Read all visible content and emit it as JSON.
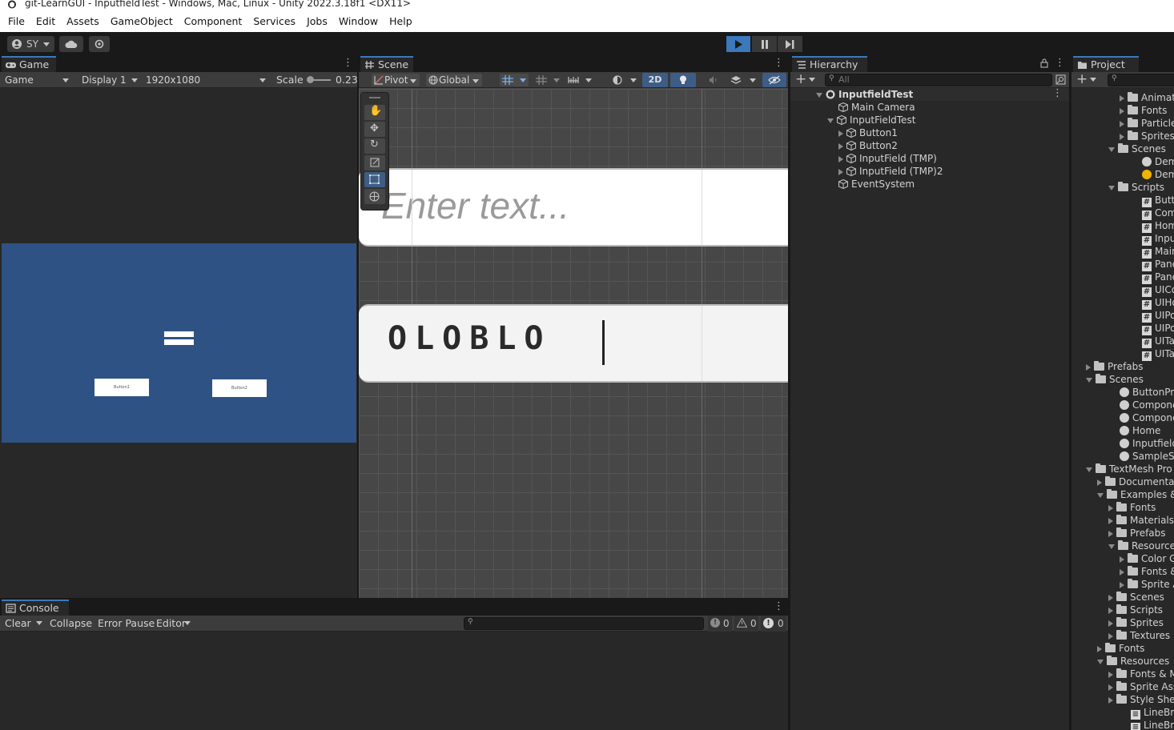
{
  "window_title": "git-LearnGUI - InputfieldTest - Windows, Mac, Linux - Unity 2022.3.18f1 <DX11>",
  "menu": [
    "File",
    "Edit",
    "Assets",
    "GameObject",
    "Component",
    "Services",
    "Jobs",
    "Window",
    "Help"
  ],
  "toolbar": {
    "account_label": "SY"
  },
  "game": {
    "tab": "Game",
    "mode": "Game",
    "display": "Display 1",
    "resolution": "1920x1080",
    "scale_label": "Scale",
    "scale_value": "0.23",
    "button1_label": "Button1",
    "button2_label": "Button2",
    "bg_color": "#2e5283"
  },
  "scene": {
    "tab": "Scene",
    "pivot": "Pivot",
    "global": "Global",
    "mode_2d": "2D",
    "input_placeholder": "Enter text...",
    "input_value": "OLOBLO"
  },
  "hierarchy": {
    "tab": "Hierarchy",
    "search_placeholder": "All",
    "root": "InputfieldTest",
    "items": [
      "Main Camera",
      "InputFieldTest",
      "Button1",
      "Button2",
      "InputField (TMP)",
      "InputField (TMP)2",
      "EventSystem"
    ]
  },
  "project": {
    "tab": "Project",
    "items": [
      "Animat",
      "Fonts",
      "Particle",
      "Sprites",
      "Scenes",
      "DemoS",
      "DemoS",
      "Scripts",
      "ButtonI",
      "Compo",
      "HomeM",
      "Inputfie",
      "Main",
      "PanelC",
      "PanelF",
      "UICom",
      "UIHom",
      "UIPopu",
      "UIPopu",
      "UITab",
      "UITabM",
      "Prefabs",
      "Scenes",
      "ButtonPract",
      "Components",
      "Components",
      "Home",
      "InputfieldTe",
      "SampleScer",
      "TextMesh Pro",
      "Documentat",
      "Examples &",
      "Fonts",
      "Materials",
      "Prefabs",
      "Resource",
      "Color G",
      "Fonts &",
      "Sprite A",
      "Scenes",
      "Scripts",
      "Sprites",
      "Textures",
      "Fonts",
      "Resources",
      "Fonts & M",
      "Sprite Ass",
      "Style She",
      "LineBreak",
      "LineBreak"
    ]
  },
  "console": {
    "tab": "Console",
    "clear": "Clear",
    "collapse": "Collapse",
    "error_pause": "Error Pause",
    "editor": "Editor",
    "info_count": "0",
    "warn_count": "0",
    "error_count": "0"
  },
  "colors": {
    "accent": "#3a79bb",
    "play_active": "#3a79bb"
  }
}
